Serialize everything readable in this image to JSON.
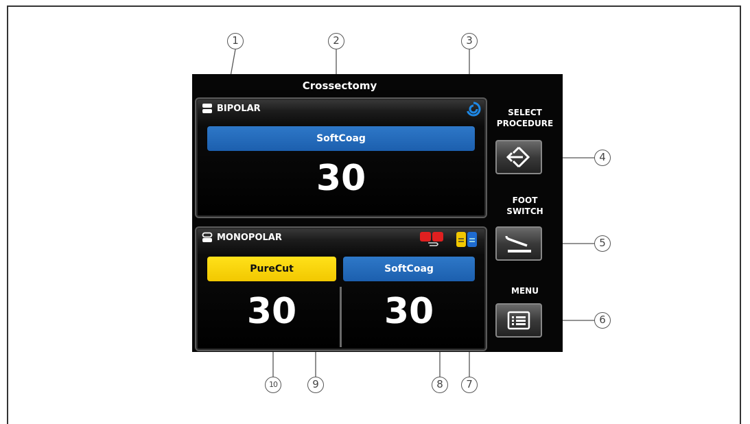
{
  "procedure_title": "Crossectomy",
  "bipolar": {
    "label": "BIPOLAR",
    "mode": "SoftCoag",
    "value": "30",
    "mode_color": "#1c5fae"
  },
  "monopolar": {
    "label": "MONOPOLAR",
    "left": {
      "mode": "PureCut",
      "value": "30",
      "mode_color": "#f2c800"
    },
    "right": {
      "mode": "SoftCoag",
      "value": "30",
      "mode_color": "#1c5fae"
    }
  },
  "sidebar": {
    "select_procedure_line1": "SELECT",
    "select_procedure_line2": "PROCEDURE",
    "foot_switch_line1": "FOOT",
    "foot_switch_line2": "SWITCH",
    "menu_label": "MENU"
  },
  "callouts": [
    "1",
    "2",
    "3",
    "4",
    "5",
    "6",
    "7",
    "8",
    "9",
    "10"
  ],
  "icons": {
    "plug": "socket-plug-icon",
    "autostart": "autostart-swirl-icon",
    "select_procedure": "select-procedure-arrow-icon",
    "foot_switch": "foot-switch-pedal-icon",
    "menu": "menu-list-icon",
    "handle_red": "red-handle-icon",
    "handle_yellow_blue": "yellow-blue-handle-icon"
  }
}
